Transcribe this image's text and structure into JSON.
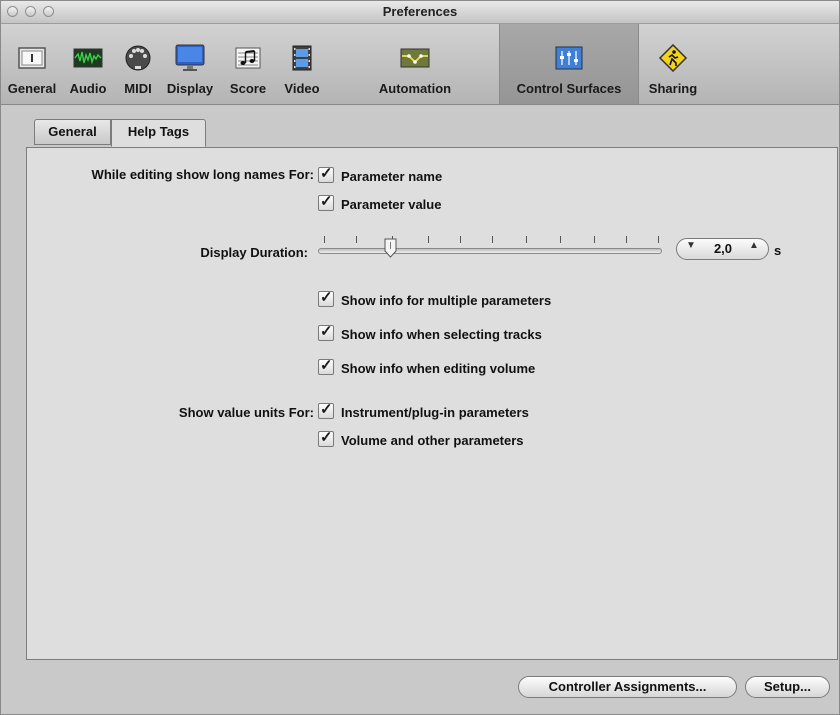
{
  "window": {
    "title": "Preferences"
  },
  "toolbar": {
    "items": [
      {
        "label": "General",
        "icon": "general-icon"
      },
      {
        "label": "Audio",
        "icon": "audio-icon"
      },
      {
        "label": "MIDI",
        "icon": "midi-icon"
      },
      {
        "label": "Display",
        "icon": "display-icon"
      },
      {
        "label": "Score",
        "icon": "score-icon"
      },
      {
        "label": "Video",
        "icon": "video-icon"
      },
      {
        "label": "Automation",
        "icon": "automation-icon"
      },
      {
        "label": "Control Surfaces",
        "icon": "control-surfaces-icon",
        "selected": true
      },
      {
        "label": "Sharing",
        "icon": "sharing-icon"
      }
    ]
  },
  "tabs": [
    {
      "label": "General",
      "active": false
    },
    {
      "label": "Help Tags",
      "active": true
    }
  ],
  "form": {
    "long_names_label": "While editing show long names For:",
    "parameter_name": {
      "label": "Parameter name",
      "checked": true
    },
    "parameter_value": {
      "label": "Parameter value",
      "checked": true
    },
    "display_duration_label": "Display Duration:",
    "display_duration_value": "2,0",
    "display_duration_unit": "s",
    "display_duration_level": 0.2,
    "show_info_multiple": {
      "label": "Show info for multiple parameters",
      "checked": true
    },
    "show_info_tracks": {
      "label": "Show info when selecting tracks",
      "checked": true
    },
    "show_info_volume": {
      "label": "Show info when editing volume",
      "checked": true
    },
    "value_units_label": "Show value units For:",
    "instrument_params": {
      "label": "Instrument/plug-in parameters",
      "checked": true
    },
    "volume_params": {
      "label": "Volume and other parameters",
      "checked": true
    }
  },
  "footer": {
    "controller_assignments": "Controller Assignments...",
    "setup": "Setup..."
  },
  "colors": {
    "automation_icon": "#8a8a2a",
    "sharing_icon": "#f2d21a",
    "control_surfaces_icon": "#3f7fd6"
  }
}
